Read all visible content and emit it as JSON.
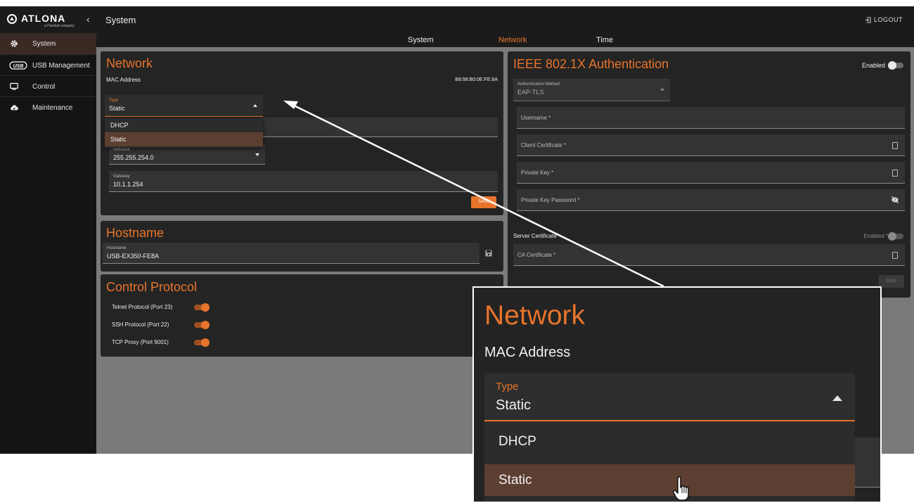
{
  "brand": {
    "name": "ATLONA",
    "sub": "a Panduit company"
  },
  "header": {
    "title": "System",
    "logout": "LOGOUT"
  },
  "sidebar": {
    "items": [
      {
        "label": "System",
        "icon": "gear-icon"
      },
      {
        "label": "USB Management",
        "icon": "usb-icon"
      },
      {
        "label": "Control",
        "icon": "monitor-icon"
      },
      {
        "label": "Maintenance",
        "icon": "cloud-icon"
      }
    ]
  },
  "tabs": [
    {
      "label": "System"
    },
    {
      "label": "Network"
    },
    {
      "label": "Time"
    }
  ],
  "network": {
    "title": "Network",
    "mac_label": "MAC Address",
    "mac_value": "B8:98:B0:0E:FE:8A",
    "type_label": "Type",
    "type_value": "Static",
    "type_options": [
      "DHCP",
      "Static"
    ],
    "netmask_label": "Netmask",
    "netmask_value": "255.255.254.0",
    "gateway_label": "Gateway",
    "gateway_value": "10.1.1.254",
    "save": "SAVE"
  },
  "hostname": {
    "title": "Hostname",
    "label": "Hostname",
    "value": "USB-EX350-FE8A"
  },
  "control": {
    "title": "Control Protocol",
    "items": [
      {
        "label": "Telnet Protocol (Port 23)",
        "enabled": true
      },
      {
        "label": "SSH Protocol (Port 22)",
        "enabled": true
      },
      {
        "label": "TCP Proxy (Port 9001)",
        "enabled": true
      }
    ]
  },
  "ieee": {
    "title": "IEEE 802.1X Authentication",
    "enabled_label": "Enabled",
    "enabled": false,
    "auth_method_label": "Authentication Method",
    "auth_method_value": "EAP-TLS",
    "username": "Username *",
    "client_cert": "Client Certificate *",
    "private_key": "Private Key *",
    "private_key_password": "Private Key Password *",
    "server_cert_label": "Server Certificate",
    "server_enabled_label": "Enabled *",
    "server_enabled": false,
    "ca_cert": "CA Certificate *",
    "save": "SAVE"
  },
  "colors": {
    "accent": "#e7742b",
    "selected": "#5c3f31",
    "panel": "#242424",
    "background": "#7a7a7a"
  }
}
